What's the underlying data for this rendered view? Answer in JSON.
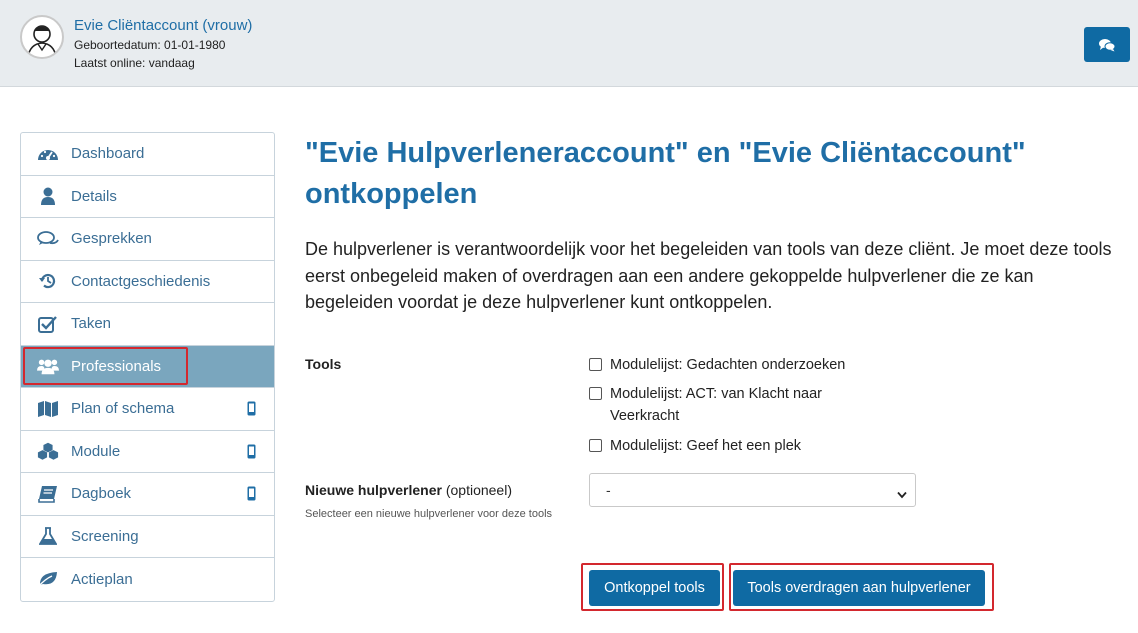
{
  "header": {
    "user_name": "Evie Cliëntaccount (vrouw)",
    "birthdate": "Geboortedatum: 01-01-1980",
    "last_online": "Laatst online: vandaag",
    "chat_icon": "chat-icon"
  },
  "sidebar": {
    "items": [
      {
        "label": "Dashboard",
        "icon": "dashboard-icon"
      },
      {
        "label": "Details",
        "icon": "user-icon"
      },
      {
        "label": "Gesprekken",
        "icon": "comments-icon"
      },
      {
        "label": "Contactgeschiedenis",
        "icon": "history-icon"
      },
      {
        "label": "Taken",
        "icon": "checkbox-icon"
      },
      {
        "label": "Professionals",
        "icon": "users-icon",
        "active": true
      },
      {
        "label": "Plan of schema",
        "icon": "map-icon",
        "mobile": true
      },
      {
        "label": "Module",
        "icon": "cubes-icon",
        "mobile": true
      },
      {
        "label": "Dagboek",
        "icon": "book-icon",
        "mobile": true
      },
      {
        "label": "Screening",
        "icon": "flask-icon"
      },
      {
        "label": "Actieplan",
        "icon": "leaf-icon"
      }
    ]
  },
  "main": {
    "title": "\"Evie Hulpverleneraccount\" en \"Evie Cliëntaccount\" ontkoppelen",
    "description": "De hulpverlener is verantwoordelijk voor het begeleiden van tools van deze cliënt. Je moet deze tools eerst onbegeleid maken of overdragen aan een andere gekoppelde hulpverlener die ze kan begeleiden voordat je deze hulpverlener kunt ontkoppelen.",
    "tools_label": "Tools",
    "tools": [
      {
        "label": "Modulelijst: Gedachten onderzoeken",
        "checked": false
      },
      {
        "label": "Modulelijst: ACT: van Klacht naar Veerkracht",
        "checked": false
      },
      {
        "label": "Modulelijst: Geef het een plek",
        "checked": false
      }
    ],
    "new_caregiver_label": "Nieuwe hulpverlener",
    "new_caregiver_optional": "(optioneel)",
    "new_caregiver_help": "Selecteer een nieuwe hulpverlener voor deze tools",
    "select_value": "-",
    "unlink_button": "Ontkoppel tools",
    "transfer_button": "Tools overdragen aan hulpverlener"
  },
  "colors": {
    "brand": "#0f6aa3",
    "active_nav": "#7aa6be",
    "highlight": "#d3282e"
  }
}
